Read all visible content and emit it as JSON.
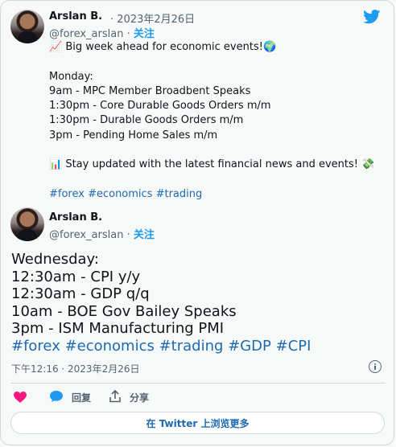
{
  "brand_color": "#1d9bf0",
  "link_color": "#1d6ab2",
  "tweet1": {
    "author": "Arslan B.",
    "separator": "·",
    "date": "2023年2月26日",
    "handle": "@forex_arslan",
    "dot": "·",
    "follow": "关注",
    "lines": [
      "📈 Big week ahead for economic events!🌍",
      "",
      "Monday:",
      "9am - MPC Member Broadbent Speaks",
      "1:30pm - Core Durable Goods Orders m/m",
      "1:30pm - Durable Goods Orders m/m",
      "3pm - Pending Home Sales m/m",
      "",
      "📊 Stay updated with the latest financial news and events! 💸",
      ""
    ],
    "hashtags": "#forex #economics #trading"
  },
  "tweet2": {
    "author": "Arslan B.",
    "handle": "@forex_arslan",
    "dot": "·",
    "follow": "关注",
    "lines": [
      "Wednesday:",
      "12:30am - CPI y/y",
      "12:30am - GDP q/q",
      "10am - BOE Gov Bailey Speaks",
      "3pm - ISM Manufacturing PMI"
    ],
    "hashtags": "#forex #economics #trading #GDP #CPI",
    "timestamp": "下午12:16 · 2023年2月26日"
  },
  "actions": {
    "reply_label": "回复",
    "share_label": "分享"
  },
  "more_button": "在 Twitter 上浏览更多",
  "icons": {
    "bird": "twitter-bird-icon",
    "heart": "heart-icon",
    "reply": "reply-bubble-icon",
    "share": "share-icon",
    "info": "info-icon"
  }
}
